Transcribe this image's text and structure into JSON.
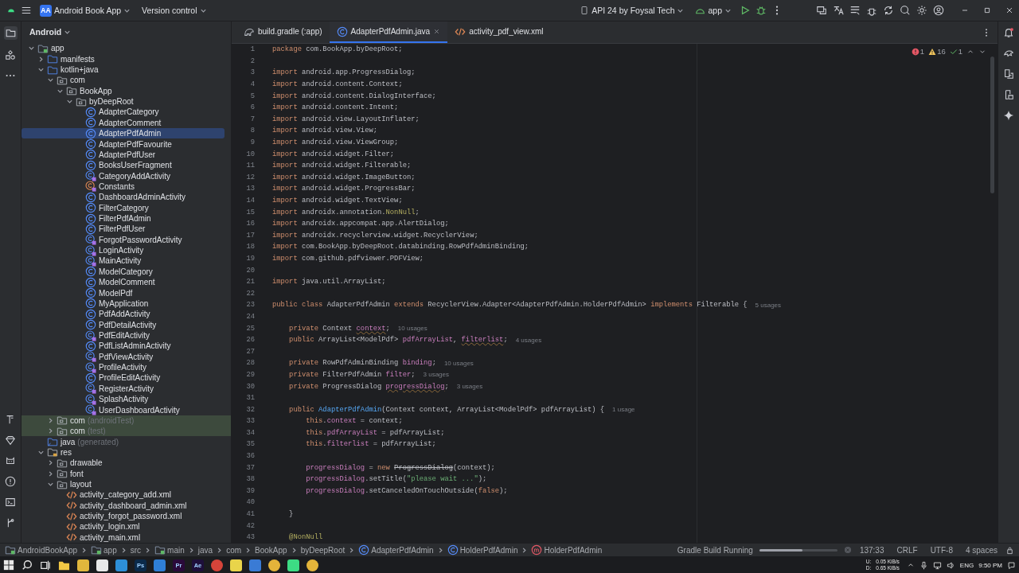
{
  "title_bar": {
    "project_badge": "AA",
    "project": "Android Book App",
    "vcs": "Version control",
    "device": "API 24 by Foysal Tech",
    "run_config": "app"
  },
  "project_panel": {
    "view": "Android",
    "tree": [
      {
        "label": "app",
        "kind": "module",
        "expanded": true,
        "selected": false,
        "children": [
          {
            "label": "manifests",
            "kind": "folder",
            "expanded": false,
            "selected": false
          },
          {
            "label": "kotlin+java",
            "kind": "folder",
            "expanded": true,
            "selected": false,
            "children": [
              {
                "label": "com",
                "kind": "package",
                "expanded": true,
                "selected": false,
                "children": [
                  {
                    "label": "BookApp",
                    "kind": "package",
                    "expanded": true,
                    "selected": false,
                    "children": [
                      {
                        "label": "byDeepRoot",
                        "kind": "package",
                        "expanded": true,
                        "selected": false,
                        "children": [
                          {
                            "label": "AdapterCategory",
                            "kind": "class",
                            "selected": false
                          },
                          {
                            "label": "AdapterComment",
                            "kind": "class",
                            "selected": false
                          },
                          {
                            "label": "AdapterPdfAdmin",
                            "kind": "class",
                            "selected": true
                          },
                          {
                            "label": "AdapterPdfFavourite",
                            "kind": "class",
                            "selected": false
                          },
                          {
                            "label": "AdapterPdfUser",
                            "kind": "class",
                            "selected": false
                          },
                          {
                            "label": "BooksUserFragment",
                            "kind": "class",
                            "selected": false
                          },
                          {
                            "label": "CategoryAddActivity",
                            "kind": "activity",
                            "selected": false
                          },
                          {
                            "label": "Constants",
                            "kind": "constant",
                            "selected": false
                          },
                          {
                            "label": "DashboardAdminActivity",
                            "kind": "class",
                            "selected": false
                          },
                          {
                            "label": "FilterCategory",
                            "kind": "class",
                            "selected": false
                          },
                          {
                            "label": "FilterPdfAdmin",
                            "kind": "class",
                            "selected": false
                          },
                          {
                            "label": "FilterPdfUser",
                            "kind": "class",
                            "selected": false
                          },
                          {
                            "label": "ForgotPasswordActivity",
                            "kind": "activity",
                            "selected": false
                          },
                          {
                            "label": "LoginActivity",
                            "kind": "activity",
                            "selected": false
                          },
                          {
                            "label": "MainActivity",
                            "kind": "activity",
                            "selected": false
                          },
                          {
                            "label": "ModelCategory",
                            "kind": "class",
                            "selected": false
                          },
                          {
                            "label": "ModelComment",
                            "kind": "class",
                            "selected": false
                          },
                          {
                            "label": "ModelPdf",
                            "kind": "class",
                            "selected": false
                          },
                          {
                            "label": "MyApplication",
                            "kind": "class",
                            "selected": false
                          },
                          {
                            "label": "PdfAddActivity",
                            "kind": "class",
                            "selected": false
                          },
                          {
                            "label": "PdfDetailActivity",
                            "kind": "class",
                            "selected": false
                          },
                          {
                            "label": "PdfEditActivity",
                            "kind": "activity",
                            "selected": false
                          },
                          {
                            "label": "PdfListAdminActivity",
                            "kind": "class",
                            "selected": false
                          },
                          {
                            "label": "PdfViewActivity",
                            "kind": "activity",
                            "selected": false
                          },
                          {
                            "label": "ProfileActivity",
                            "kind": "activity",
                            "selected": false
                          },
                          {
                            "label": "ProfileEditActivity",
                            "kind": "class",
                            "selected": false
                          },
                          {
                            "label": "RegisterActivity",
                            "kind": "activity",
                            "selected": false
                          },
                          {
                            "label": "SplashActivity",
                            "kind": "activity",
                            "selected": false
                          },
                          {
                            "label": "UserDashboardActivity",
                            "kind": "activity",
                            "selected": false
                          }
                        ]
                      }
                    ]
                  }
                ]
              },
              {
                "label": "com",
                "suffix": "(androidTest)",
                "kind": "package",
                "expanded": false,
                "selected": false,
                "highlighted": true
              },
              {
                "label": "com",
                "suffix": "(test)",
                "kind": "package",
                "expanded": false,
                "selected": false,
                "highlighted": true
              }
            ]
          },
          {
            "label": "java",
            "suffix": "(generated)",
            "kind": "generated",
            "selected": false
          },
          {
            "label": "res",
            "kind": "res",
            "expanded": true,
            "selected": false,
            "children": [
              {
                "label": "drawable",
                "kind": "package",
                "expanded": false,
                "selected": false
              },
              {
                "label": "font",
                "kind": "package",
                "expanded": false,
                "selected": false
              },
              {
                "label": "layout",
                "kind": "package",
                "expanded": true,
                "selected": false,
                "children": [
                  {
                    "label": "activity_category_add.xml",
                    "kind": "xml",
                    "selected": false
                  },
                  {
                    "label": "activity_dashboard_admin.xml",
                    "kind": "xml",
                    "selected": false
                  },
                  {
                    "label": "activity_forgot_password.xml",
                    "kind": "xml",
                    "selected": false
                  },
                  {
                    "label": "activity_login.xml",
                    "kind": "xml",
                    "selected": false
                  },
                  {
                    "label": "activity_main.xml",
                    "kind": "xml",
                    "selected": false
                  }
                ]
              }
            ]
          }
        ]
      }
    ]
  },
  "editor_tabs": [
    {
      "label": "build.gradle (:app)",
      "kind": "gradle",
      "selected": false
    },
    {
      "label": "AdapterPdfAdmin.java",
      "kind": "class",
      "selected": true
    },
    {
      "label": "activity_pdf_view.xml",
      "kind": "xml",
      "selected": false
    }
  ],
  "inspections": {
    "errors": "1",
    "warnings": "16",
    "passed": "1"
  },
  "code_lines": [
    {
      "number": "1",
      "tokens": [
        {
          "kind": "kw",
          "text": "package"
        },
        {
          "kind": "txt",
          "text": " com.BookApp.byDeepRoot;"
        }
      ]
    },
    {
      "number": "2"
    },
    {
      "number": "3",
      "tokens": [
        {
          "kind": "kw",
          "text": "import"
        },
        {
          "kind": "txt",
          "text": " android.app.ProgressDialog;"
        }
      ]
    },
    {
      "number": "4",
      "tokens": [
        {
          "kind": "kw",
          "text": "import"
        },
        {
          "kind": "txt",
          "text": " android.content.Context;"
        }
      ]
    },
    {
      "number": "5",
      "tokens": [
        {
          "kind": "kw",
          "text": "import"
        },
        {
          "kind": "txt",
          "text": " android.content.DialogInterface;"
        }
      ]
    },
    {
      "number": "6",
      "tokens": [
        {
          "kind": "kw",
          "text": "import"
        },
        {
          "kind": "txt",
          "text": " android.content.Intent;"
        }
      ]
    },
    {
      "number": "7",
      "tokens": [
        {
          "kind": "kw",
          "text": "import"
        },
        {
          "kind": "txt",
          "text": " android.view.LayoutInflater;"
        }
      ]
    },
    {
      "number": "8",
      "tokens": [
        {
          "kind": "kw",
          "text": "import"
        },
        {
          "kind": "txt",
          "text": " android.view.View;"
        }
      ]
    },
    {
      "number": "9",
      "tokens": [
        {
          "kind": "kw",
          "text": "import"
        },
        {
          "kind": "txt",
          "text": " android.view.ViewGroup;"
        }
      ]
    },
    {
      "number": "10",
      "tokens": [
        {
          "kind": "kw",
          "text": "import"
        },
        {
          "kind": "txt",
          "text": " android.widget.Filter;"
        }
      ]
    },
    {
      "number": "11",
      "tokens": [
        {
          "kind": "kw",
          "text": "import"
        },
        {
          "kind": "txt",
          "text": " android.widget.Filterable;"
        }
      ]
    },
    {
      "number": "12",
      "tokens": [
        {
          "kind": "kw",
          "text": "import"
        },
        {
          "kind": "txt",
          "text": " android.widget.ImageButton;"
        }
      ]
    },
    {
      "number": "13",
      "tokens": [
        {
          "kind": "kw",
          "text": "import"
        },
        {
          "kind": "txt",
          "text": " android.widget.ProgressBar;"
        }
      ]
    },
    {
      "number": "14",
      "tokens": [
        {
          "kind": "kw",
          "text": "import"
        },
        {
          "kind": "txt",
          "text": " android.widget.TextView;"
        }
      ]
    },
    {
      "number": "15",
      "tokens": [
        {
          "kind": "kw",
          "text": "import"
        },
        {
          "kind": "txt",
          "text": " androidx.annotation."
        },
        {
          "kind": "ann",
          "text": "NonNull"
        },
        {
          "kind": "txt",
          "text": ";"
        }
      ]
    },
    {
      "number": "16",
      "tokens": [
        {
          "kind": "kw",
          "text": "import"
        },
        {
          "kind": "txt",
          "text": " androidx.appcompat.app.AlertDialog;"
        }
      ]
    },
    {
      "number": "17",
      "tokens": [
        {
          "kind": "kw",
          "text": "import"
        },
        {
          "kind": "txt",
          "text": " androidx.recyclerview.widget.RecyclerView;"
        }
      ]
    },
    {
      "number": "18",
      "tokens": [
        {
          "kind": "kw",
          "text": "import"
        },
        {
          "kind": "txt",
          "text": " com.BookApp.byDeepRoot.databinding.RowPdfAdminBinding;"
        }
      ]
    },
    {
      "number": "19",
      "tokens": [
        {
          "kind": "kw",
          "text": "import"
        },
        {
          "kind": "txt",
          "text": " com.github.pdfviewer.PDFView;"
        }
      ]
    },
    {
      "number": "20"
    },
    {
      "number": "21",
      "tokens": [
        {
          "kind": "kw",
          "text": "import"
        },
        {
          "kind": "txt",
          "text": " java.util.ArrayList;"
        }
      ]
    },
    {
      "number": "22"
    },
    {
      "number": "23",
      "tokens": [
        {
          "kind": "kw",
          "text": "public class"
        },
        {
          "kind": "txt",
          "text": " AdapterPdfAdmin "
        },
        {
          "kind": "kw",
          "text": "extends"
        },
        {
          "kind": "txt",
          "text": " RecyclerView.Adapter<AdapterPdfAdmin.HolderPdfAdmin> "
        },
        {
          "kind": "kw",
          "text": "implements"
        },
        {
          "kind": "txt",
          "text": " Filterable {"
        }
      ],
      "hint": "5 usages"
    },
    {
      "number": "24"
    },
    {
      "number": "25",
      "tokens": [
        {
          "kind": "kw",
          "text": "    private"
        },
        {
          "kind": "txt",
          "text": " Context "
        },
        {
          "kind": "fldw",
          "text": "context"
        },
        {
          "kind": "txt",
          "text": ";"
        }
      ],
      "hint": "10 usages"
    },
    {
      "number": "26",
      "tokens": [
        {
          "kind": "kw",
          "text": "    public"
        },
        {
          "kind": "txt",
          "text": " ArrayList<ModelPdf> "
        },
        {
          "kind": "fld",
          "text": "pdfArrayList"
        },
        {
          "kind": "txt",
          "text": ", "
        },
        {
          "kind": "fldw",
          "text": "filterlist"
        },
        {
          "kind": "txt",
          "text": ";"
        }
      ],
      "hint": "4 usages"
    },
    {
      "number": "27"
    },
    {
      "number": "28",
      "tokens": [
        {
          "kind": "kw",
          "text": "    private"
        },
        {
          "kind": "txt",
          "text": " RowPdfAdminBinding "
        },
        {
          "kind": "fld",
          "text": "binding"
        },
        {
          "kind": "txt",
          "text": ";"
        }
      ],
      "hint": "10 usages"
    },
    {
      "number": "29",
      "tokens": [
        {
          "kind": "kw",
          "text": "    private"
        },
        {
          "kind": "txt",
          "text": " FilterPdfAdmin "
        },
        {
          "kind": "fld",
          "text": "filter"
        },
        {
          "kind": "txt",
          "text": ";"
        }
      ],
      "hint": "3 usages"
    },
    {
      "number": "30",
      "tokens": [
        {
          "kind": "kw",
          "text": "    private"
        },
        {
          "kind": "txt",
          "text": " ProgressDialog "
        },
        {
          "kind": "fldw",
          "text": "progressDialog"
        },
        {
          "kind": "txt",
          "text": ";"
        }
      ],
      "hint": "3 usages"
    },
    {
      "number": "31"
    },
    {
      "number": "32",
      "tokens": [
        {
          "kind": "kw",
          "text": "    public "
        },
        {
          "kind": "decl",
          "text": "AdapterPdfAdmin"
        },
        {
          "kind": "txt",
          "text": "(Context context, ArrayList<ModelPdf> pdfArrayList) {"
        }
      ],
      "hint": "1 usage"
    },
    {
      "number": "33",
      "tokens": [
        {
          "kind": "kw",
          "text": "        this"
        },
        {
          "kind": "txt",
          "text": "."
        },
        {
          "kind": "fld",
          "text": "context"
        },
        {
          "kind": "txt",
          "text": " = context;"
        }
      ]
    },
    {
      "number": "34",
      "tokens": [
        {
          "kind": "kw",
          "text": "        this"
        },
        {
          "kind": "txt",
          "text": "."
        },
        {
          "kind": "fld",
          "text": "pdfArrayList"
        },
        {
          "kind": "txt",
          "text": " = pdfArrayList;"
        }
      ]
    },
    {
      "number": "35",
      "tokens": [
        {
          "kind": "kw",
          "text": "        this"
        },
        {
          "kind": "txt",
          "text": "."
        },
        {
          "kind": "fld",
          "text": "filterlist"
        },
        {
          "kind": "txt",
          "text": " = pdfArrayList;"
        }
      ]
    },
    {
      "number": "36"
    },
    {
      "number": "37",
      "tokens": [
        {
          "kind": "fld",
          "text": "        progressDialog"
        },
        {
          "kind": "txt",
          "text": " = "
        },
        {
          "kind": "kw",
          "text": "new "
        },
        {
          "kind": "depr",
          "text": "ProgressDialog"
        },
        {
          "kind": "txt",
          "text": "(context);"
        }
      ]
    },
    {
      "number": "38",
      "tokens": [
        {
          "kind": "fld",
          "text": "        progressDialog"
        },
        {
          "kind": "txt",
          "text": ".setTitle("
        },
        {
          "kind": "str",
          "text": "\"please wait ...\""
        },
        {
          "kind": "txt",
          "text": ");"
        }
      ]
    },
    {
      "number": "39",
      "tokens": [
        {
          "kind": "fld",
          "text": "        progressDialog"
        },
        {
          "kind": "txt",
          "text": ".setCanceledOnTouchOutside("
        },
        {
          "kind": "kw",
          "text": "false"
        },
        {
          "kind": "txt",
          "text": ");"
        }
      ]
    },
    {
      "number": "40"
    },
    {
      "number": "41",
      "tokens": [
        {
          "kind": "txt",
          "text": "    }"
        }
      ]
    },
    {
      "number": "42"
    },
    {
      "number": "43",
      "tokens": [
        {
          "kind": "ann",
          "text": "    @NonNull"
        }
      ]
    }
  ],
  "breadcrumbs": [
    {
      "label": "AndroidBookApp",
      "kind": "module"
    },
    {
      "label": "app",
      "kind": "module"
    },
    {
      "label": "src"
    },
    {
      "label": "main",
      "kind": "module"
    },
    {
      "label": "java"
    },
    {
      "label": "com"
    },
    {
      "label": "BookApp"
    },
    {
      "label": "byDeepRoot"
    },
    {
      "label": "AdapterPdfAdmin",
      "kind": "class"
    },
    {
      "label": "HolderPdfAdmin",
      "kind": "class"
    },
    {
      "label": "HolderPdfAdmin",
      "kind": "method"
    }
  ],
  "status_bar": {
    "task": "Gradle Build Running",
    "progress": {
      "level": 0.55
    },
    "position": "137:33",
    "line_separator": "CRLF",
    "encoding": "UTF-8",
    "indent": "4 spaces"
  },
  "taskbar": {
    "apps": [
      {
        "kind": "folder",
        "color": "#f2c744"
      },
      {
        "kind": "square",
        "color": "#e0b73c"
      },
      {
        "kind": "square",
        "color": "#e8e8e8"
      },
      {
        "kind": "square",
        "color": "#2d8fd8"
      },
      {
        "kind": "square",
        "color": "#0b2a4a",
        "label": "Ps"
      },
      {
        "kind": "square",
        "color": "#2f7fd6"
      },
      {
        "kind": "square",
        "color": "#2a0a3a",
        "label": "Pr"
      },
      {
        "kind": "square",
        "color": "#1e0f3b",
        "label": "Ae"
      },
      {
        "kind": "circle",
        "color": "#d6443a"
      },
      {
        "kind": "square",
        "color": "#e9d44a"
      },
      {
        "kind": "square",
        "color": "#3a7bd5"
      },
      {
        "kind": "circle",
        "color": "#e4b43a"
      },
      {
        "kind": "square",
        "color": "#3ddc84"
      },
      {
        "kind": "circle",
        "color": "#e4b43a"
      }
    ],
    "upload": "U:",
    "upload_rate": "0.05 KiB/s",
    "download": "D:",
    "download_rate": "0.65 KiB/s",
    "language": "ENG",
    "time": "9:50 PM"
  }
}
